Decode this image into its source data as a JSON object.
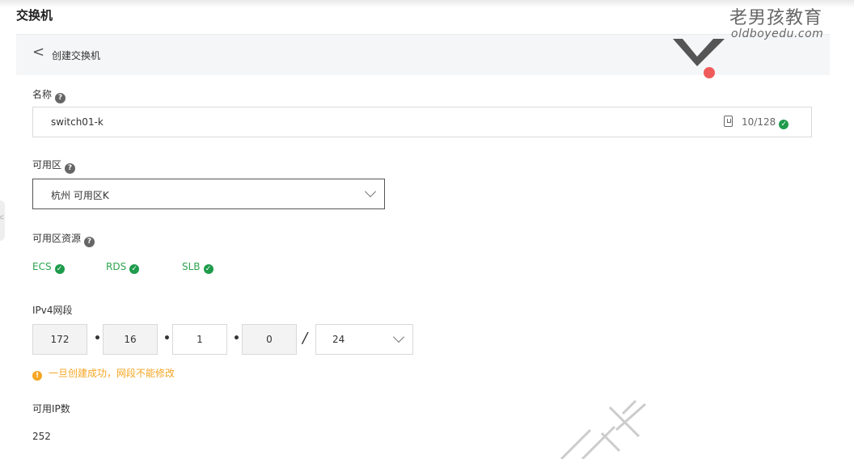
{
  "page": {
    "title": "交换机"
  },
  "header": {
    "back_label": "<",
    "title": "创建交换机"
  },
  "logo": {
    "cn": "老男孩教育",
    "en": "oldboyedu.com",
    "colors": {
      "chevron": "#555555",
      "dot": "#ef5b5b"
    }
  },
  "form": {
    "name": {
      "label": "名称",
      "value": "switch01-k",
      "counter": "10/128"
    },
    "zone": {
      "label": "可用区",
      "value": "杭州 可用区K"
    },
    "resources": {
      "label": "可用区资源",
      "items": [
        "ECS",
        "RDS",
        "SLB"
      ]
    },
    "ipv4": {
      "label": "IPv4网段",
      "octets": [
        "172",
        "16",
        "1",
        "0"
      ],
      "separator": "•",
      "slash": "/",
      "mask": "24",
      "warning": "一旦创建成功，网段不能修改"
    },
    "available_ip": {
      "label": "可用IP数",
      "value": "252"
    }
  },
  "icons": {
    "help": "?",
    "check": "✓",
    "warn": "!",
    "handle": "<"
  },
  "colors": {
    "success": "#2da44e",
    "warning": "#f5a623",
    "check_badge": "#1e9b4b"
  }
}
